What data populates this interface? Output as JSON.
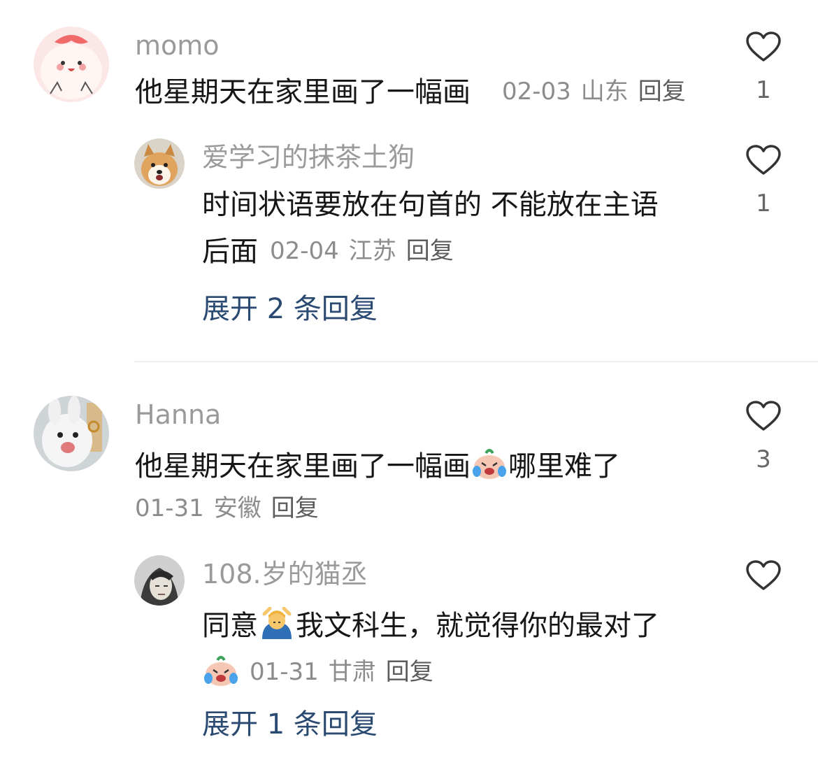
{
  "comments": [
    {
      "username": "momo",
      "text": "他星期天在家里画了一幅画",
      "date": "02-03",
      "location": "山东",
      "reply_label": "回复",
      "likes": "1",
      "avatar": "pink-blob-character-avatar",
      "replies": [
        {
          "username": "爱学习的抹茶土狗",
          "text_line1": "时间状语要放在句首的 不能放在主语",
          "text_line2": "后面",
          "date": "02-04",
          "location": "江苏",
          "reply_label": "回复",
          "likes": "1",
          "avatar": "shiba-dog-avatar"
        }
      ],
      "expand_label": "展开 2 条回复"
    },
    {
      "username": "Hanna",
      "text_before": "他星期天在家里画了一幅画",
      "emoji": "crying-laughing-blob-emoji",
      "text_after": "哪里难了",
      "date": "01-31",
      "location": "安徽",
      "reply_label": "回复",
      "likes": "3",
      "avatar": "white-rabbit-avatar",
      "replies": [
        {
          "username": "108.岁的猫丞",
          "text_before": "同意",
          "emoji": "person-praying-emoji",
          "text_after": "我文科生，就觉得你的最对了",
          "line2_emoji": "crying-laughing-blob-emoji",
          "date": "01-31",
          "location": "甘肃",
          "reply_label": "回复",
          "avatar": "sketch-portrait-avatar"
        }
      ],
      "expand_label": "展开 1 条回复"
    }
  ],
  "colors": {
    "username": "#9a9a9a",
    "text": "#161616",
    "meta": "#8c8c8c",
    "expand_link": "#2b4a72",
    "heart_outline": "#333333"
  }
}
